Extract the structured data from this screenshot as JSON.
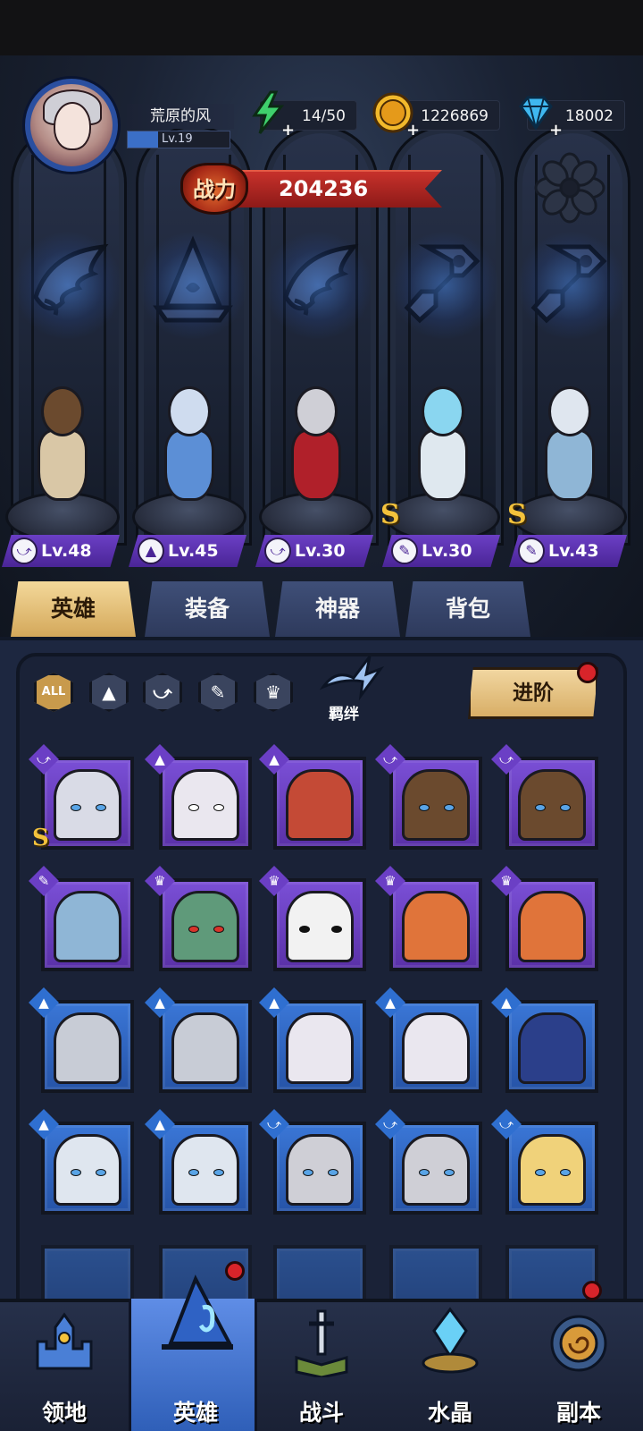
{
  "player": {
    "name": "荒原的风",
    "level": "Lv.19",
    "level_progress": 0.3
  },
  "resources": {
    "energy": "14/50",
    "gold": "1226869",
    "diamonds": "18002"
  },
  "power": {
    "label": "战力",
    "value": "204236"
  },
  "lineup": [
    {
      "level": "Lv.48",
      "class_icon": "wing-icon"
    },
    {
      "level": "Lv.45",
      "class_icon": "mage-hat-icon"
    },
    {
      "level": "Lv.30",
      "class_icon": "wing-icon"
    },
    {
      "level": "Lv.30",
      "class_icon": "wrench-icon",
      "s_rank": "S"
    },
    {
      "level": "Lv.43",
      "class_icon": "wrench-icon",
      "s_rank": "S"
    }
  ],
  "tabs": [
    "英雄",
    "装备",
    "神器",
    "背包"
  ],
  "filters": {
    "all_label": "ALL",
    "bond_label": "羁绊",
    "advance_label": "进阶"
  },
  "nav": [
    "领地",
    "英雄",
    "战斗",
    "水晶",
    "副本"
  ],
  "colors": {
    "accent_gold": "#d4a85a",
    "rarity_purple": "#6b3fc5",
    "rarity_blue": "#2f6fd0",
    "power_red": "#c7312b"
  }
}
